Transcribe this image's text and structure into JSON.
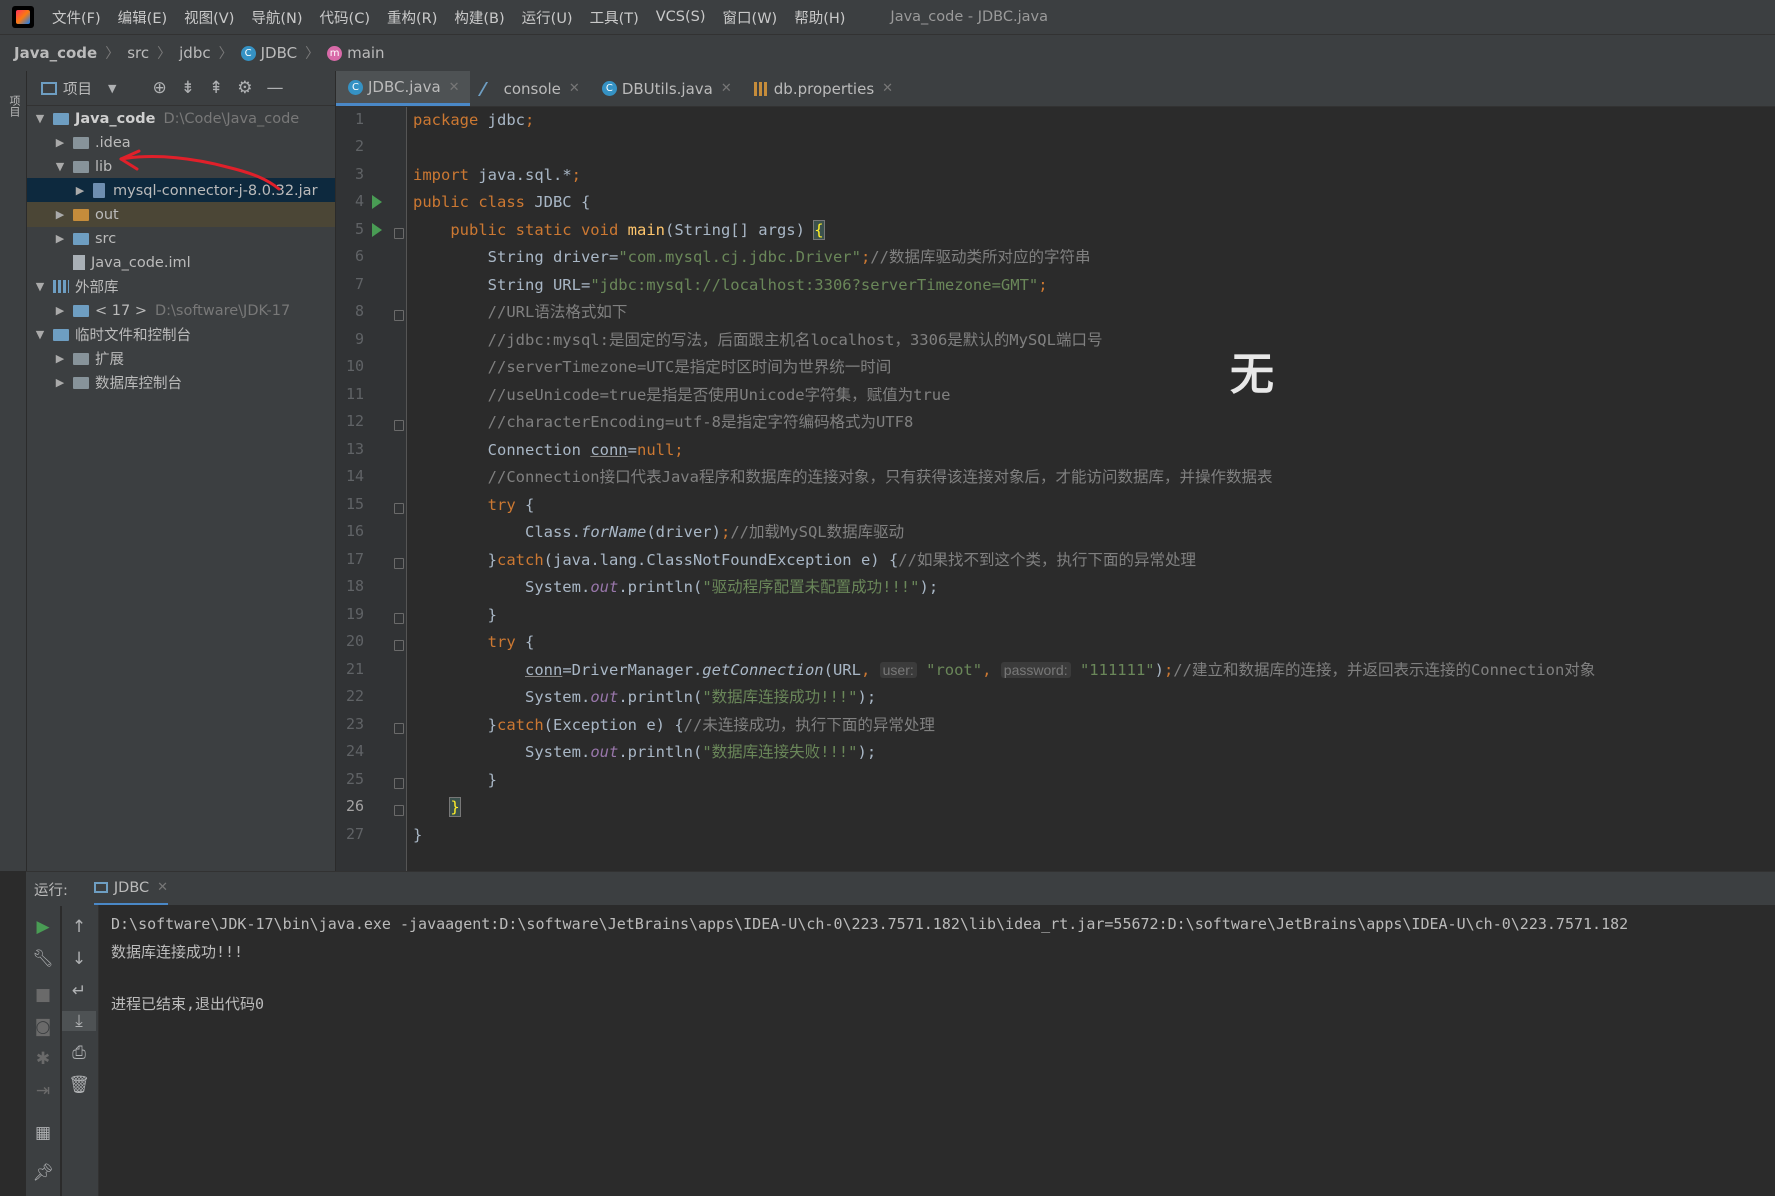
{
  "menubar": {
    "items": [
      "文件(F)",
      "编辑(E)",
      "视图(V)",
      "导航(N)",
      "代码(C)",
      "重构(R)",
      "构建(B)",
      "运行(U)",
      "工具(T)",
      "VCS(S)",
      "窗口(W)",
      "帮助(H)"
    ],
    "window_title": "Java_code - JDBC.java"
  },
  "breadcrumb": {
    "project": "Java_code",
    "src": "src",
    "package": "jdbc",
    "class": "JDBC",
    "method": "main"
  },
  "stripe": {
    "project_label": "项目"
  },
  "project_panel": {
    "title": "项目",
    "tree": {
      "root": "Java_code",
      "root_path": "D:\\Code\\Java_code",
      "idea": ".idea",
      "lib": "lib",
      "jar": "mysql-connector-j-8.0.32.jar",
      "out": "out",
      "src": "src",
      "iml": "Java_code.iml",
      "external_libs": "外部库",
      "jdk": "< 17 >",
      "jdk_path": "D:\\software\\JDK-17",
      "scratches": "临时文件和控制台",
      "extensions": "扩展",
      "db_consoles": "数据库控制台"
    }
  },
  "editor": {
    "tabs": [
      "JDBC.java",
      "console",
      "DBUtils.java",
      "db.properties"
    ],
    "active_tab": "JDBC.java",
    "line_numbers": [
      "1",
      "2",
      "3",
      "4",
      "5",
      "6",
      "7",
      "8",
      "9",
      "10",
      "11",
      "12",
      "13",
      "14",
      "15",
      "16",
      "17",
      "18",
      "19",
      "20",
      "21",
      "22",
      "23",
      "24",
      "25",
      "26",
      "27"
    ],
    "code": {
      "l1_kw": "package",
      "l1_rest": " jdbc",
      "l1_semi": ";",
      "l3_kw": "import",
      "l3_rest": " java.sql.*",
      "l3_semi": ";",
      "l4_kw": "public class",
      "l4_rest": " JDBC {",
      "l5_kw": "public static void",
      "l5_fn": "main",
      "l5_rest": "(String[] args) ",
      "l6_pre": "String driver=",
      "l6_str": "\"com.mysql.cj.jdbc.Driver\"",
      "l6_semi": ";",
      "l6_cmt": "//数据库驱动类所对应的字符串",
      "l7_pre": "String URL=",
      "l7_str": "\"jdbc:mysql://localhost:3306?serverTimezone=GMT\"",
      "l7_semi": ";",
      "l8": "//URL语法格式如下",
      "l9": "//jdbc:mysql:是固定的写法，后面跟主机名localhost，3306是默认的MySQL端口号",
      "l10": "//serverTimezone=UTC是指定时区时间为世界统一时间",
      "l11": "//useUnicode=true是指是否使用Unicode字符集，赋值为true",
      "l12": "//characterEncoding=utf-8是指定字符编码格式为UTF8",
      "l13_pre": "Connection ",
      "l13_var": "conn",
      "l13_eq": "=",
      "l13_null": "null;",
      "l14": "//Connection接口代表Java程序和数据库的连接对象，只有获得该连接对象后，才能访问数据库，并操作数据表",
      "l15_kw": "try",
      "l15_rest": " {",
      "l16_pre": "Class.",
      "l16_fn": "forName",
      "l16_rest": "(driver)",
      "l16_semi": ";",
      "l16_cmt": "//加载MySQL数据库驱动",
      "l17_pre": "}",
      "l17_kw": "catch",
      "l17_rest": "(java.lang.ClassNotFoundException e) {",
      "l17_cmt": "//如果找不到这个类，执行下面的异常处理",
      "l18_pre": "System.",
      "l18_fld": "out",
      "l18_mid": ".println(",
      "l18_str": "\"驱动程序配置未配置成功!!!\"",
      "l18_end": ");",
      "l19": "}",
      "l20_kw": "try",
      "l20_rest": " {",
      "l21_var": "conn",
      "l21_pre": "=DriverManager.",
      "l21_fn": "getConnection",
      "l21_a": "(URL",
      "l21_comma": ",",
      "l21_hint_user": "user:",
      "l21_str1": "\"root\"",
      "l21_comma2": ",",
      "l21_hint_pwd": "password:",
      "l21_str2": "\"111111\"",
      "l21_end": ")",
      "l21_semi": ";",
      "l21_cmt": "//建立和数据库的连接，并返回表示连接的Connection对象",
      "l22_pre": "System.",
      "l22_fld": "out",
      "l22_mid": ".println(",
      "l22_str": "\"数据库连接成功!!!\"",
      "l22_end": ");",
      "l23_pre": "}",
      "l23_kw": "catch",
      "l23_rest": "(Exception e) {",
      "l23_cmt": "//未连接成功，执行下面的异常处理",
      "l24_pre": "System.",
      "l24_fld": "out",
      "l24_mid": ".println(",
      "l24_str": "\"数据库连接失败!!!\"",
      "l24_end": ");",
      "l25": "}",
      "l26": "}",
      "l27": "}"
    },
    "watermark": "无"
  },
  "run": {
    "label": "运行:",
    "tab": "JDBC",
    "output": [
      "D:\\software\\JDK-17\\bin\\java.exe -javaagent:D:\\software\\JetBrains\\apps\\IDEA-U\\ch-0\\223.7571.182\\lib\\idea_rt.jar=55672:D:\\software\\JetBrains\\apps\\IDEA-U\\ch-0\\223.7571.182",
      "数据库连接成功!!!",
      "",
      "进程已结束,退出代码0"
    ]
  },
  "colors": {
    "keyword": "#cc7832",
    "string": "#6a8759",
    "comment": "#808080",
    "function": "#ffc66d",
    "field": "#9876aa",
    "accent": "#4a88c7",
    "annotation_arrow": "#e0202a"
  },
  "icons": [
    "app-logo",
    "crosshair-icon",
    "expand-all-icon",
    "collapse-all-icon",
    "gear-icon",
    "hide-icon",
    "run-icon",
    "wrench-icon",
    "stop-icon",
    "camera-icon",
    "debug-icon",
    "exit-icon",
    "layout-icon",
    "pin-icon",
    "up-arrow-icon",
    "down-arrow-icon",
    "soft-wrap-icon",
    "scroll-end-icon",
    "print-icon",
    "trash-icon"
  ]
}
